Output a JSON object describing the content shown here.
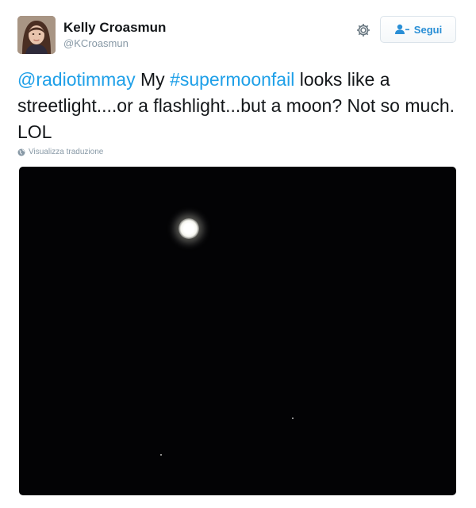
{
  "user": {
    "display_name": "Kelly Croasmun",
    "handle": "@KCroasmun"
  },
  "actions": {
    "settings_icon": "gear-icon",
    "follow_icon": "add-user-icon",
    "follow_label": "Segui"
  },
  "tweet": {
    "mention": "@radiotimmay",
    "text_1": " My ",
    "hashtag": "#supermoonfail",
    "text_2": " looks like a streetlight....or a flashlight...but a moon? Not so much. LOL"
  },
  "translate": {
    "icon": "globe-icon",
    "label": "Visualizza traduzione"
  },
  "media": {
    "description_icon": "night-sky-photo",
    "background_color": "#030305",
    "accent_color": "#1fa0e8"
  }
}
